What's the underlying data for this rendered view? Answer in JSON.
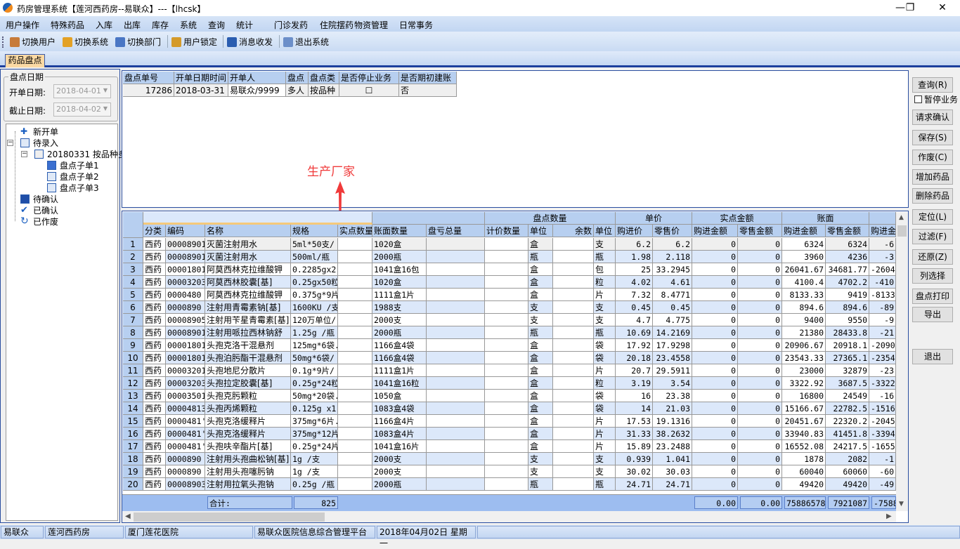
{
  "title": "药房管理系统【莲河西药房--易联众】---【lhcsk】",
  "window_controls": {
    "minimize": "—",
    "restore": "❐",
    "close": "✕"
  },
  "menu": [
    "用户操作",
    "特殊药品",
    "入库",
    "出库",
    "库存",
    "系统",
    "查询",
    "统计",
    "门诊发药",
    "住院摆药",
    "物资管理",
    "日常事务"
  ],
  "toolbar": [
    "切换用户",
    "切换系统",
    "切换部门",
    "用户锁定",
    "消息收发",
    "退出系统"
  ],
  "tab": "药品盘点",
  "left": {
    "group": "盘点日期",
    "start_label": "开单日期:",
    "start_value": "2018-04-01",
    "end_label": "截止日期:",
    "end_value": "2018-04-02",
    "tree": [
      "新开单",
      "待录入",
      "20180331 按品种多",
      "盘点子单1",
      "盘点子单2",
      "盘点子单3",
      "待确认",
      "已确认",
      "已作废"
    ]
  },
  "top_grid": {
    "headers": [
      "盘点单号",
      "开单日期时间",
      "开单人",
      "盘点",
      "盘点类",
      "是否停止业务",
      "是否期初建账"
    ],
    "row": [
      "17286",
      "2018-03-31",
      "易联众/9999",
      "多人",
      "按品种",
      "☐",
      "否"
    ]
  },
  "annotation": "生产厂家",
  "grid": {
    "group_headers": [
      "盘点数量",
      "单价",
      "实点金额",
      "账面"
    ],
    "headers": [
      "分类",
      "编码",
      "名称",
      "规格",
      "实点数量",
      "账面数量",
      "盘亏总量",
      "计价数量",
      "单位",
      "余数",
      "单位",
      "购进价",
      "零售价",
      "购进金额",
      "零售金额",
      "购进金额",
      "零售金额",
      "购进金额"
    ],
    "rows": [
      [
        "1",
        "西药",
        "00008901",
        "灭菌注射用水",
        "5ml*50支/",
        "",
        "1020盒",
        "",
        "",
        "盒",
        "",
        "支",
        "6.2",
        "6.2",
        "0",
        "0",
        "6324",
        "6324",
        "-6"
      ],
      [
        "2",
        "西药",
        "00008901",
        "灭菌注射用水",
        "500ml/瓶",
        "",
        "2000瓶",
        "",
        "",
        "瓶",
        "",
        "瓶",
        "1.98",
        "2.118",
        "0",
        "0",
        "3960",
        "4236",
        "-3"
      ],
      [
        "3",
        "西药",
        "00001801",
        "阿莫西林克拉维酸钾",
        "0.2285gx2",
        "",
        "1041盒16包",
        "",
        "",
        "盒",
        "",
        "包",
        "25",
        "33.2945",
        "0",
        "0",
        "26041.67",
        "34681.77",
        "-2604"
      ],
      [
        "4",
        "西药",
        "00003203",
        "阿莫西林胶囊[基]",
        "0.25gx50粒",
        "",
        "1020盒",
        "",
        "",
        "盒",
        "",
        "粒",
        "4.02",
        "4.61",
        "0",
        "0",
        "4100.4",
        "4702.2",
        "-410"
      ],
      [
        "5",
        "西药",
        "0000480",
        "阿莫西林克拉维酸钾",
        "0.375g*9片",
        "",
        "1111盒1片",
        "",
        "",
        "盒",
        "",
        "片",
        "7.32",
        "8.4771",
        "0",
        "0",
        "8133.33",
        "9419",
        "-8133"
      ],
      [
        "6",
        "西药",
        "0000890",
        "注射用青霉素钠[基]",
        "1600KU /支",
        "",
        "1988支",
        "",
        "",
        "支",
        "",
        "支",
        "0.45",
        "0.45",
        "0",
        "0",
        "894.6",
        "894.6",
        "-89"
      ],
      [
        "7",
        "西药",
        "00008905",
        "注射用苄星青霉素[基]",
        "120万单位/",
        "",
        "2000支",
        "",
        "",
        "支",
        "",
        "支",
        "4.7",
        "4.775",
        "0",
        "0",
        "9400",
        "9550",
        "-9"
      ],
      [
        "8",
        "西药",
        "00008901",
        "注射用哌拉西林钠舒",
        "1.25g /瓶",
        "",
        "2000瓶",
        "",
        "",
        "瓶",
        "",
        "瓶",
        "10.69",
        "14.2169",
        "0",
        "0",
        "21380",
        "28433.8",
        "-21"
      ],
      [
        "9",
        "西药",
        "00001801",
        "头孢克洛干混悬剂",
        "125mg*6袋.",
        "",
        "1166盒4袋",
        "",
        "",
        "盒",
        "",
        "袋",
        "17.92",
        "17.9298",
        "0",
        "0",
        "20906.67",
        "20918.1",
        "-2090"
      ],
      [
        "10",
        "西药",
        "00001801",
        "头孢泊肟酯干混悬剂",
        "50mg*6袋/",
        "",
        "1166盒4袋",
        "",
        "",
        "盒",
        "",
        "袋",
        "20.18",
        "23.4558",
        "0",
        "0",
        "23543.33",
        "27365.1",
        "-2354"
      ],
      [
        "11",
        "西药",
        "00003201",
        "头孢地尼分散片",
        "0.1g*9片/",
        "",
        "1111盒1片",
        "",
        "",
        "盒",
        "",
        "片",
        "20.7",
        "29.5911",
        "0",
        "0",
        "23000",
        "32879",
        "-23"
      ],
      [
        "12",
        "西药",
        "00003203",
        "头孢拉定胶囊[基]",
        "0.25g*24粒",
        "",
        "1041盒16粒",
        "",
        "",
        "盒",
        "",
        "粒",
        "3.19",
        "3.54",
        "0",
        "0",
        "3322.92",
        "3687.5",
        "-3322"
      ],
      [
        "13",
        "西药",
        "00003501",
        "头孢克肟颗粒",
        "50mg*20袋.",
        "",
        "1050盒",
        "",
        "",
        "盒",
        "",
        "袋",
        "16",
        "23.38",
        "0",
        "0",
        "16800",
        "24549",
        "-16"
      ],
      [
        "14",
        "西药",
        "00004813",
        "头孢丙烯颗粒",
        "0.125g x1",
        "",
        "1083盒4袋",
        "",
        "",
        "盒",
        "",
        "袋",
        "14",
        "21.03",
        "0",
        "0",
        "15166.67",
        "22782.5",
        "-1516"
      ],
      [
        "15",
        "西药",
        "0000481'",
        "头孢克洛缓释片",
        "375mg*6片.",
        "",
        "1166盒4片",
        "",
        "",
        "盒",
        "",
        "片",
        "17.53",
        "19.1316",
        "0",
        "0",
        "20451.67",
        "22320.2",
        "-2045"
      ],
      [
        "16",
        "西药",
        "0000481'",
        "头孢克洛缓释片",
        "375mg*12片",
        "",
        "1083盒4片",
        "",
        "",
        "盒",
        "",
        "片",
        "31.33",
        "38.2632",
        "0",
        "0",
        "33940.83",
        "41451.8",
        "-3394"
      ],
      [
        "17",
        "西药",
        "0000481'",
        "头孢呋辛酯片[基]",
        "0.25g*24片",
        "",
        "1041盒16片",
        "",
        "",
        "盒",
        "",
        "片",
        "15.89",
        "23.2488",
        "0",
        "0",
        "16552.08",
        "24217.5",
        "-1655"
      ],
      [
        "18",
        "西药",
        "0000890",
        "注射用头孢曲松钠[基]",
        "1g /支",
        "",
        "2000支",
        "",
        "",
        "支",
        "",
        "支",
        "0.939",
        "1.041",
        "0",
        "0",
        "1878",
        "2082",
        "-1"
      ],
      [
        "19",
        "西药",
        "0000890",
        "注射用头孢噻肟钠",
        "1g /支",
        "",
        "2000支",
        "",
        "",
        "支",
        "",
        "支",
        "30.02",
        "30.03",
        "0",
        "0",
        "60040",
        "60060",
        "-60"
      ],
      [
        "20",
        "西药",
        "00008903",
        "注射用拉氧头孢钠",
        "0.25g /瓶",
        "",
        "2000瓶",
        "",
        "",
        "瓶",
        "",
        "瓶",
        "24.71",
        "24.71",
        "0",
        "0",
        "49420",
        "49420",
        "-49"
      ]
    ],
    "totals": {
      "label": "合计:",
      "qty": "825",
      "buy_amt": "0.00",
      "sell_amt": "0.00",
      "book_buy": "75886578",
      "book_sell": "7921087",
      "diff": "-7588"
    }
  },
  "right": {
    "query": "查询(R)",
    "pause": "暂停业务",
    "buttons": [
      "请求确认",
      "保存(S)",
      "作废(C)",
      "增加药品",
      "删除药品",
      "定位(L)",
      "过滤(F)",
      "还原(Z)",
      "列选择",
      "盘点打印",
      "导出"
    ],
    "exit": "退出"
  },
  "status": [
    "易联众",
    "莲河西药房",
    "厦门莲花医院",
    "易联众医院信息综合管理平台",
    "2018年04月02日 星期一"
  ]
}
